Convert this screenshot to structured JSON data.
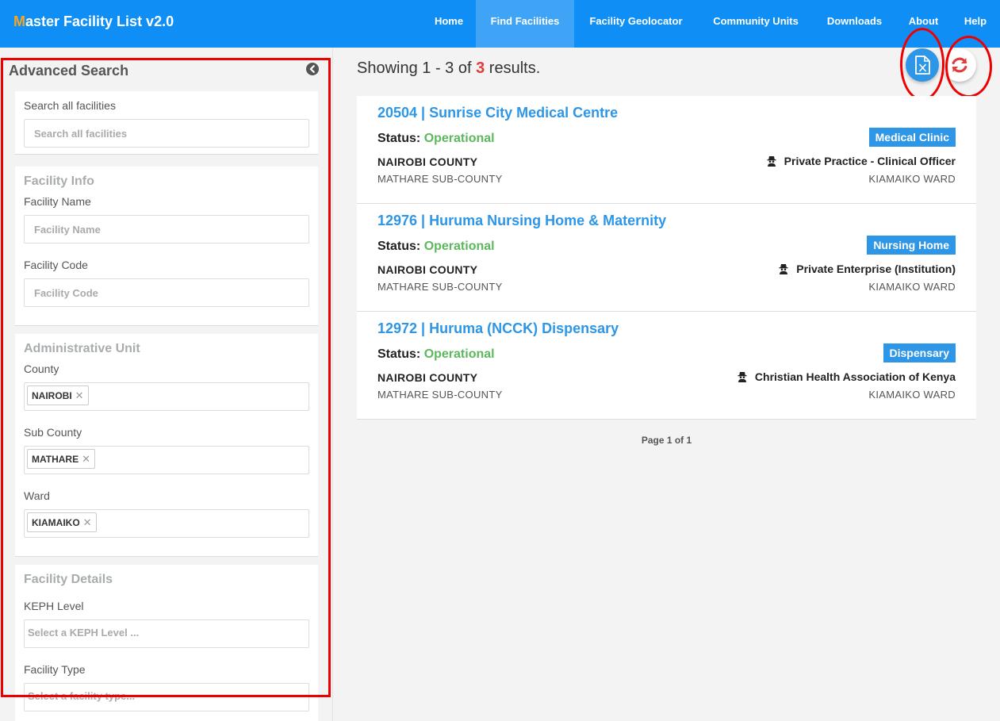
{
  "navbar": {
    "brand_first": "M",
    "brand_rest": "aster Facility List v2.0",
    "items": [
      {
        "label": "Home"
      },
      {
        "label": "Find Facilities",
        "active": true
      },
      {
        "label": "Facility Geolocator"
      },
      {
        "label": "Community Units"
      },
      {
        "label": "Downloads"
      },
      {
        "label": "About"
      },
      {
        "label": "Help"
      }
    ]
  },
  "sidebar": {
    "title": "Advanced Search",
    "search": {
      "label": "Search all facilities",
      "placeholder": "Search all facilities"
    },
    "facility_info": {
      "title": "Facility Info",
      "name_label": "Facility Name",
      "name_placeholder": "Facility Name",
      "code_label": "Facility Code",
      "code_placeholder": "Facility Code"
    },
    "admin_unit": {
      "title": "Administrative Unit",
      "county_label": "County",
      "county_value": "NAIROBI",
      "subcounty_label": "Sub County",
      "subcounty_value": "MATHARE",
      "ward_label": "Ward",
      "ward_value": "KIAMAIKO"
    },
    "facility_details": {
      "title": "Facility Details",
      "keph_label": "KEPH Level",
      "keph_placeholder": "Select a KEPH Level ...",
      "type_label": "Facility Type",
      "type_placeholder": "Select a facility type..."
    }
  },
  "main": {
    "results_prefix": "Showing 1 - 3 of",
    "results_total": "3",
    "results_suffix": "results.",
    "pager": "Page 1 of 1",
    "facilities": [
      {
        "title": "20504 | Sunrise City Medical Centre",
        "status_label": "Status:",
        "status": "Operational",
        "type": "Medical Clinic",
        "county": "NAIROBI COUNTY",
        "owner": "Private Practice - Clinical Officer",
        "subcounty": "MATHARE SUB-COUNTY",
        "ward": "KIAMAIKO WARD"
      },
      {
        "title": "12976 | Huruma Nursing Home & Maternity",
        "status_label": "Status:",
        "status": "Operational",
        "type": "Nursing Home",
        "county": "NAIROBI COUNTY",
        "owner": "Private Enterprise (Institution)",
        "subcounty": "MATHARE SUB-COUNTY",
        "ward": "KIAMAIKO WARD"
      },
      {
        "title": "12972 | Huruma (NCCK) Dispensary",
        "status_label": "Status:",
        "status": "Operational",
        "type": "Dispensary",
        "county": "NAIROBI COUNTY",
        "owner": "Christian Health Association of Kenya",
        "subcounty": "MATHARE SUB-COUNTY",
        "ward": "KIAMAIKO WARD"
      }
    ]
  },
  "colors": {
    "navbar": "#0f8ff5",
    "accent": "#2d96e6",
    "status_ok": "#5cb85c",
    "count_highlight": "#e23b3b",
    "annotation": "#ee0000"
  }
}
